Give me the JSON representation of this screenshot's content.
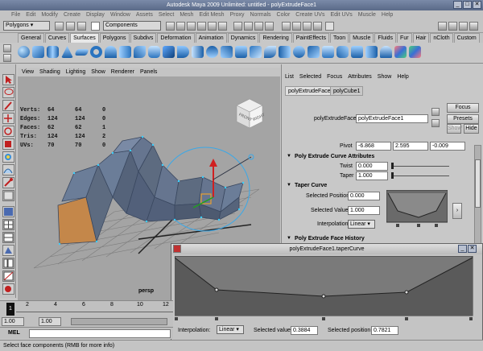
{
  "window": {
    "title": "Autodesk Maya 2009 Unlimited: untitled  -  polyExtrudeFace1",
    "controls": [
      "_",
      "□",
      "✕"
    ]
  },
  "menubar": [
    "File",
    "Edit",
    "Modify",
    "Create",
    "Display",
    "Window",
    "Assets",
    "Select",
    "Mesh",
    "Edit Mesh",
    "Proxy",
    "Normals",
    "Color",
    "Create UVs",
    "Edit UVs",
    "Muscle",
    "Help"
  ],
  "statusline": {
    "menuset": "Polygons",
    "selection_mode": "Components"
  },
  "shelf_tabs": [
    "General",
    "Curves",
    "Surfaces",
    "Polygons",
    "Subdivs",
    "Deformation",
    "Animation",
    "Dynamics",
    "Rendering",
    "PaintEffects",
    "Toon",
    "Muscle",
    "Fluids",
    "Fur",
    "Hair",
    "nCloth",
    "Custom"
  ],
  "shelf_active": "Surfaces",
  "viewport": {
    "menu": [
      "View",
      "Shading",
      "Lighting",
      "Show",
      "Renderer",
      "Panels"
    ],
    "camera": "persp",
    "viewcube_label": "RIGHT",
    "viewcube_front": "FRONT",
    "hud": [
      {
        "k": "Verts:",
        "a": "64",
        "b": "64",
        "c": "0"
      },
      {
        "k": "Edges:",
        "a": "124",
        "b": "124",
        "c": "0"
      },
      {
        "k": "Faces:",
        "a": "62",
        "b": "62",
        "c": "1"
      },
      {
        "k": "Tris:",
        "a": "124",
        "b": "124",
        "c": "2"
      },
      {
        "k": "UVs:",
        "a": "70",
        "b": "70",
        "c": "0"
      }
    ]
  },
  "attribute_editor": {
    "menu": [
      "List",
      "Selected",
      "Focus",
      "Attributes",
      "Show",
      "Help"
    ],
    "tabs": [
      "polyExtrudeFace1",
      "polyCube1"
    ],
    "node_label": "polyExtrudeFace:",
    "node_value": "polyExtrudeFace1",
    "buttons": {
      "focus": "Focus",
      "presets": "Presets",
      "show": "Show",
      "hide": "Hide"
    },
    "pivot": {
      "label": "Pivot",
      "x": "-6.868",
      "y": "2.595",
      "z": "-0.009"
    },
    "curve_section": "Poly Extrude Curve Attributes",
    "twist": {
      "label": "Twist",
      "value": "0.000",
      "level": 0.0
    },
    "taper": {
      "label": "Taper",
      "value": "1.000",
      "level": 0.0
    },
    "taper_curve_section": "Taper Curve",
    "selected_position": {
      "label": "Selected Position",
      "value": "0.000"
    },
    "selected_value": {
      "label": "Selected Value",
      "value": "1.000"
    },
    "interpolation": {
      "label": "Interpolation",
      "value": "Linear"
    },
    "face_history_section": "Poly Extrude Face History"
  },
  "graph_window": {
    "title": "polyExtrudeFace1.taperCurve",
    "interpolation_label": "Interpolation:",
    "interpolation_value": "Linear",
    "selected_value_label": "Selected value:",
    "selected_value": "0.3884",
    "selected_position_label": "Selected position:",
    "selected_position": "0.7821"
  },
  "timeline": {
    "ticks": [
      "2",
      "4",
      "6",
      "8",
      "10",
      "12"
    ],
    "current": "1",
    "start": "1.00",
    "end": "1.00"
  },
  "mel_label": "MEL",
  "help_line": "Select face components (RMB for more info)",
  "colors": {
    "mesh": "#5d6b80",
    "selected_face": "#c4874a",
    "accent_blue": "#3a8fd6"
  }
}
